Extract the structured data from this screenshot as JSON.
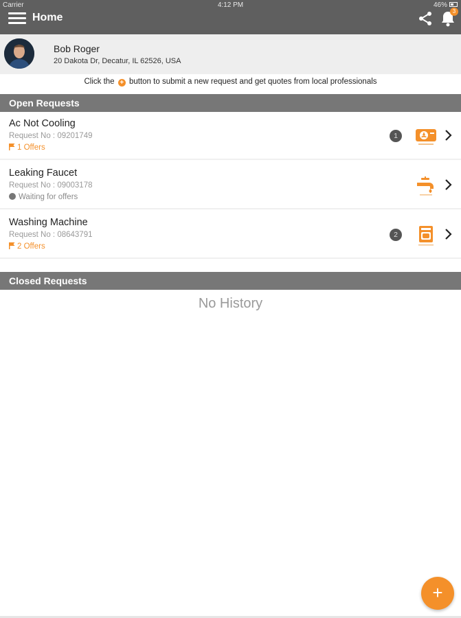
{
  "status_bar": {
    "carrier": "Carrier",
    "time": "4:12 PM",
    "battery": "46%"
  },
  "header": {
    "title": "Home",
    "notification_count": "3"
  },
  "profile": {
    "name": "Bob Roger",
    "address": "20 Dakota Dr, Decatur, IL 62526, USA"
  },
  "hint": {
    "before": "Click the",
    "after": "button to submit a new request and get quotes from local professionals"
  },
  "open_requests": {
    "title": "Open Requests",
    "items": [
      {
        "title": "Ac Not Cooling",
        "request_no": "Request No : 09201749",
        "status": "1 Offers",
        "badge": "1",
        "icon": "ac-service-icon"
      },
      {
        "title": "Leaking Faucet",
        "request_no": "Request No : 09003178",
        "status": "Waiting for offers",
        "badge": "",
        "icon": "faucet-icon"
      },
      {
        "title": "Washing Machine",
        "request_no": "Request No : 08643791",
        "status": "2 Offers",
        "badge": "2",
        "icon": "washing-machine-icon"
      }
    ]
  },
  "closed_requests": {
    "title": "Closed Requests",
    "empty_text": "No History"
  },
  "colors": {
    "accent": "#f4902a",
    "topbar": "#5f5f5f",
    "section_header": "#777777"
  }
}
